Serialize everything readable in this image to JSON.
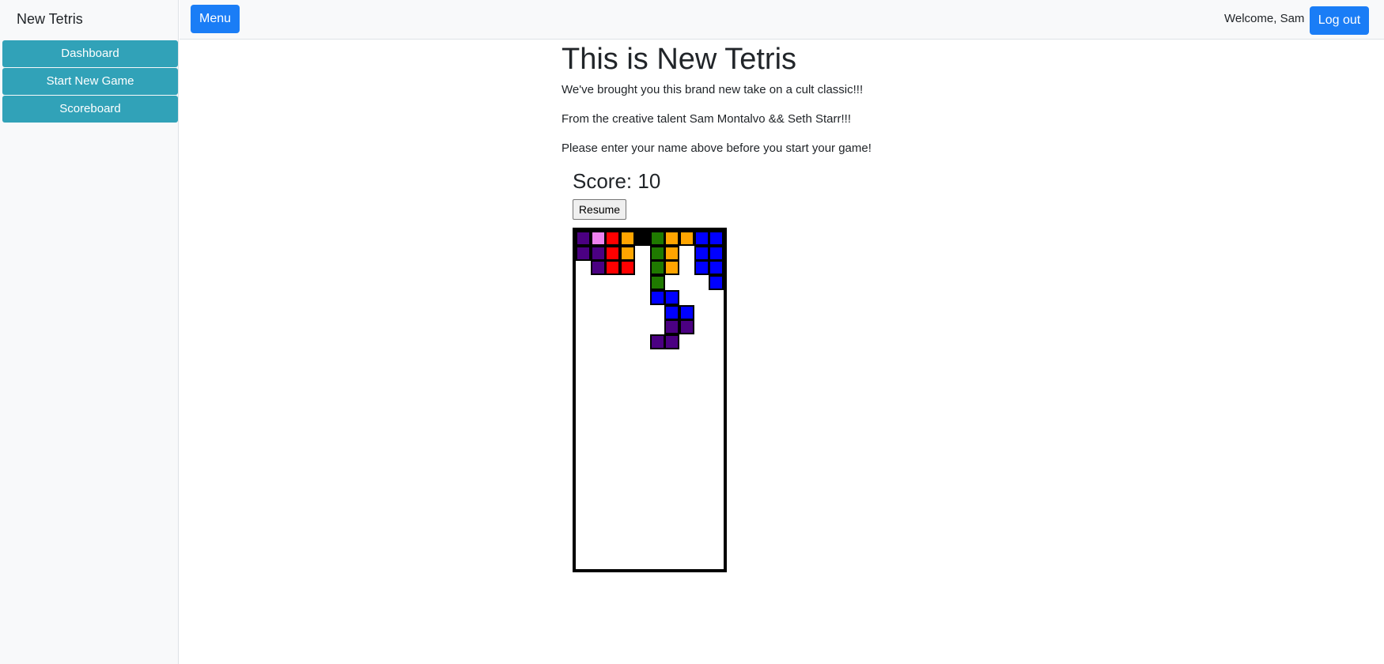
{
  "sidebar": {
    "title": "New Tetris",
    "items": [
      {
        "label": "Dashboard"
      },
      {
        "label": "Start New Game"
      },
      {
        "label": "Scoreboard"
      }
    ]
  },
  "header": {
    "menu_label": "Menu",
    "welcome": "Welcome, Sam",
    "logout_label": "Log out"
  },
  "main": {
    "title": "This is New Tetris",
    "intro": [
      "We've brought you this brand new take on a cult classic!!!",
      "From the creative talent Sam Montalvo && Seth Starr!!!",
      "Please enter your name above before you start your game!"
    ],
    "score_label": "Score:",
    "score_value": "10",
    "resume_label": "Resume"
  },
  "board": {
    "colors": {
      "P": "#4b0082",
      "V": "#ee82ee",
      "R": "#ff0000",
      "O": "#ffa500",
      "G": "#1f7a00",
      "B": "#0000ff"
    },
    "rows": [
      "PVRO.GOOBB",
      "PPRO.GO.BB",
      ".PRR.GO.BB",
      ".....G...B",
      ".....BB...",
      "......BB..",
      "......PP..",
      ".....PP..."
    ]
  }
}
